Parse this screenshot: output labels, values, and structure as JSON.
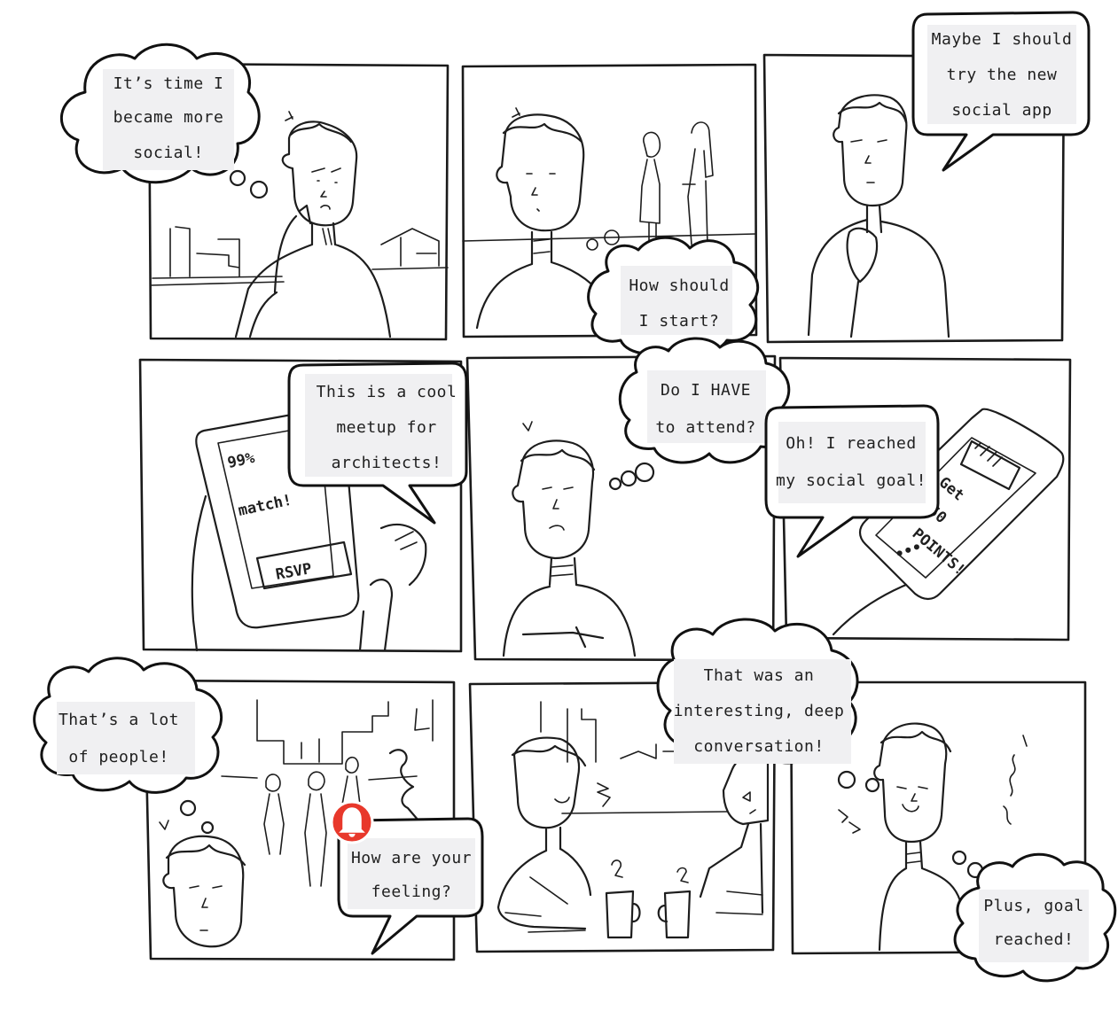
{
  "panels": [
    {
      "id": "p1",
      "caption": "It's time I became more social!",
      "lines": [
        "It's time I",
        "became more",
        "social!"
      ]
    },
    {
      "id": "p2",
      "caption": "How should I start?",
      "lines": [
        "How should",
        "I start?"
      ]
    },
    {
      "id": "p3",
      "caption": "Maybe I should try the new social app",
      "lines": [
        "Maybe I should",
        "try the new",
        "social app"
      ]
    },
    {
      "id": "p4",
      "caption": "This is a cool meetup for architects!",
      "lines": [
        "This is a cool",
        "meetup for",
        "architects!"
      ],
      "phone": {
        "match": "99% match!",
        "button": "RSVP"
      }
    },
    {
      "id": "p5",
      "caption": "Do I HAVE to attend?",
      "lines": [
        "Do I HAVE",
        "to attend?"
      ]
    },
    {
      "id": "p6",
      "caption": "Oh! I reached my social goal!",
      "lines": [
        "Oh! I reached",
        "my social goal!"
      ],
      "phone": {
        "text": [
          "Get",
          "50",
          "POINTS!"
        ],
        "dots": "..."
      }
    },
    {
      "id": "p7",
      "caption": "That's a lot of people!",
      "lines": [
        "That's a lot",
        "of people!"
      ],
      "notification": {
        "lines": [
          "How are your",
          "feeling?"
        ],
        "icon": "bell-icon",
        "color": "#e8382b"
      }
    },
    {
      "id": "p8",
      "caption": "That was an interesting, deep conversation!",
      "lines": [
        "That was an",
        "interesting, deep",
        "conversation!"
      ]
    },
    {
      "id": "p9",
      "caption": "Plus, goal reached!",
      "lines": [
        "Plus, goal",
        "reached!"
      ]
    }
  ],
  "bubbles": {
    "p1": [
      "It’s time I",
      "became more",
      "social!"
    ],
    "p2": [
      "How should",
      "I start?"
    ],
    "p3": [
      "Maybe I should",
      "try the new",
      "social app"
    ],
    "p4": [
      "This is a cool",
      "meetup for",
      "architects!"
    ],
    "p5": [
      "Do I HAVE",
      "to attend?"
    ],
    "p6": [
      "Oh! I reached",
      "my social goal!"
    ],
    "p7": [
      "That’s a lot",
      "of people!"
    ],
    "p7n": [
      "How are your",
      "feeling?"
    ],
    "p8": [
      "That was an",
      "interesting, deep",
      "conversation!"
    ],
    "p9": [
      "Plus, goal",
      "reached!"
    ]
  },
  "phone4": {
    "match_line1": "99%",
    "match_line2": "match!",
    "button": "RSVP"
  },
  "phone6": {
    "line1": "Get",
    "line2": "50",
    "line3": "POINTS!",
    "dots": "•••"
  }
}
